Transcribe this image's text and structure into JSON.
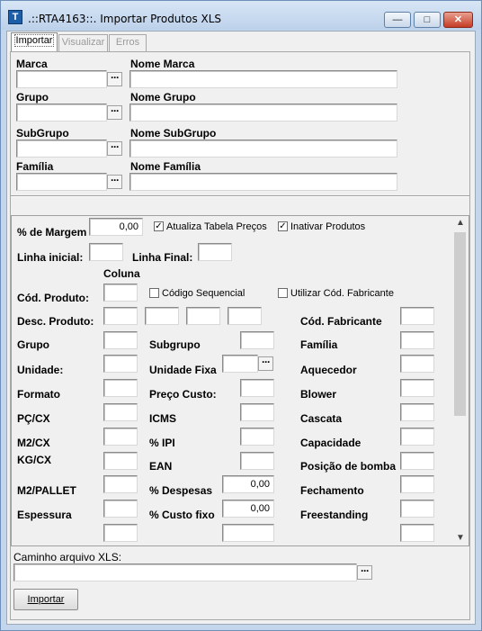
{
  "window": {
    "title": ".::RTA4163::. Importar Produtos XLS",
    "minimize_glyph": "—",
    "maximize_glyph": "□",
    "close_glyph": "✕",
    "app_icon_glyph": "T"
  },
  "tabs": [
    {
      "label": "Importar"
    },
    {
      "label": "Visualizar"
    },
    {
      "label": "Erros"
    }
  ],
  "filters": {
    "marca_label": "Marca",
    "nome_marca_label": "Nome Marca",
    "grupo_label": "Grupo",
    "nome_grupo_label": "Nome Grupo",
    "subgrupo_label": "SubGrupo",
    "nome_subgrupo_label": "Nome SubGrupo",
    "familia_label": "Família",
    "nome_familia_label": "Nome Família",
    "lookup_glyph": "···"
  },
  "options": {
    "margem_label": "% de Margem",
    "margem_value": "0,00",
    "atualiza_label": "Atualiza Tabela Preços",
    "atualiza_checked": true,
    "inativar_label": "Inativar Produtos",
    "inativar_checked": true,
    "linha_inicial_label": "Linha inicial:",
    "linha_final_label": "Linha Final:",
    "coluna_header": "Coluna",
    "cod_produto_label": "Cód. Produto:",
    "codigo_sequencial_label": "Código Sequencial",
    "utilizar_cod_fab_label": "Utilizar Cód. Fabricante",
    "desc_produto_label": "Desc. Produto:",
    "cod_fabricante_label": "Cód. Fabricante",
    "grupo_label": "Grupo",
    "subgrupo_label": "Subgrupo",
    "familia_label": "Família",
    "unidade_label": "Unidade:",
    "unidade_fixa_label": "Unidade Fixa",
    "aquecedor_label": "Aquecedor",
    "formato_label": "Formato",
    "preco_custo_label": "Preço Custo:",
    "blower_label": "Blower",
    "pc_cx_label": "PÇ/CX",
    "icms_label": "ICMS",
    "cascata_label": "Cascata",
    "m2_cx_label": "M2/CX",
    "ipi_label": "% IPI",
    "capacidade_label": "Capacidade",
    "kg_cx_label": "KG/CX",
    "ean_label": "EAN",
    "posicao_bomba_label": "Posição de bomba",
    "m2_pallet_label": "M2/PALLET",
    "despesas_label": "% Despesas",
    "despesas_value": "0,00",
    "fechamento_label": "Fechamento",
    "espessura_label": "Espessura",
    "custo_fixo_label": "% Custo fixo",
    "custo_fixo_value": "0,00",
    "freestanding_label": "Freestanding"
  },
  "file": {
    "caminho_label": "Caminho arquivo XLS:",
    "importar_button": "Importar"
  }
}
